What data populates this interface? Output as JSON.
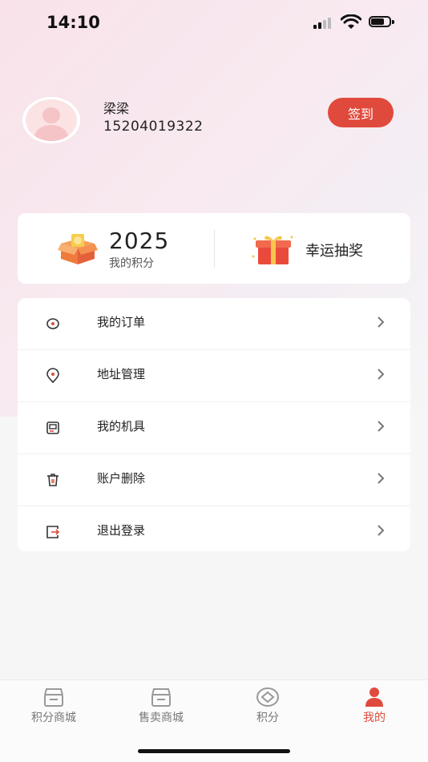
{
  "status_bar": {
    "time": "14:10"
  },
  "profile": {
    "name": "梁梁",
    "phone": "15204019322",
    "checkin_label": "签到"
  },
  "points_card": {
    "points_value": "2025",
    "points_label": "我的积分",
    "lottery_label": "幸运抽奖"
  },
  "menu": [
    {
      "label": "我的订单",
      "icon": "order-icon"
    },
    {
      "label": "地址管理",
      "icon": "location-icon"
    },
    {
      "label": "我的机具",
      "icon": "device-icon"
    },
    {
      "label": "账户删除",
      "icon": "trash-icon"
    },
    {
      "label": "退出登录",
      "icon": "logout-icon"
    }
  ],
  "tabs": [
    {
      "label": "积分商城",
      "icon": "store-icon",
      "active": false
    },
    {
      "label": "售卖商城",
      "icon": "store-icon",
      "active": false
    },
    {
      "label": "积分",
      "icon": "points-icon",
      "active": false
    },
    {
      "label": "我的",
      "icon": "user-icon",
      "active": true
    }
  ],
  "colors": {
    "accent": "#e04a3c",
    "background": "#f6f6f6",
    "card": "#ffffff"
  }
}
